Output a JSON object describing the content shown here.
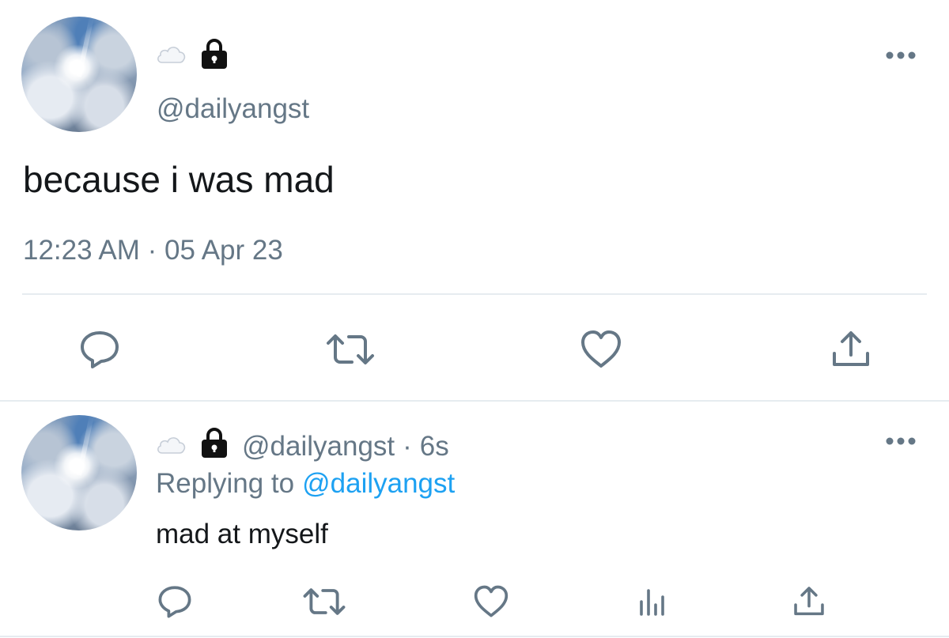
{
  "main_tweet": {
    "display_name_icon": "cloud-emoji",
    "protected_icon": "lock-icon",
    "handle": "@dailyangst",
    "text": "because i was mad",
    "timestamp": "12:23 AM · 05 Apr 23",
    "actions": [
      "reply-icon",
      "retweet-icon",
      "like-icon",
      "share-icon"
    ]
  },
  "reply_tweet": {
    "display_name_icon": "cloud-emoji",
    "protected_icon": "lock-icon",
    "handle": "@dailyangst",
    "separator": "·",
    "age": "6s",
    "replying_label": "Replying to",
    "replying_to": "@dailyangst",
    "text": "mad at myself",
    "actions": [
      "reply-icon",
      "retweet-icon",
      "like-icon",
      "analytics-icon",
      "share-icon"
    ]
  },
  "colors": {
    "text": "#14171a",
    "muted": "#657786",
    "link": "#1da1f2",
    "divider": "#e6ecf0"
  }
}
